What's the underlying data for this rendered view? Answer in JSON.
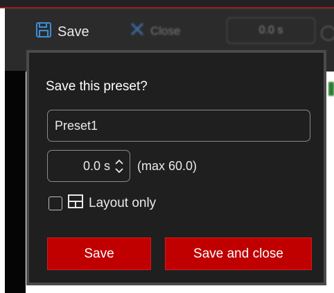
{
  "toolbar": {
    "save_label": "Save",
    "close_label": "Close",
    "duration_value": "0.0 s"
  },
  "popup": {
    "title": "Save this preset?",
    "name_input_value": "Preset1",
    "duration_value": "0.0 s",
    "max_label": "(max 60.0)",
    "layout_only_label": "Layout only",
    "layout_only_checked": false,
    "save_button": "Save",
    "save_and_close_button": "Save and close"
  },
  "colors": {
    "accent_red": "#c00000",
    "panel_bg": "#1f1f1f",
    "toolbar_bg": "#2b2b2b",
    "save_icon_blue": "#3b8fd8"
  },
  "icons": {
    "toolbar_save": "floppy-disk-icon",
    "toolbar_close": "close-x-icon",
    "layout": "layout-icon"
  }
}
